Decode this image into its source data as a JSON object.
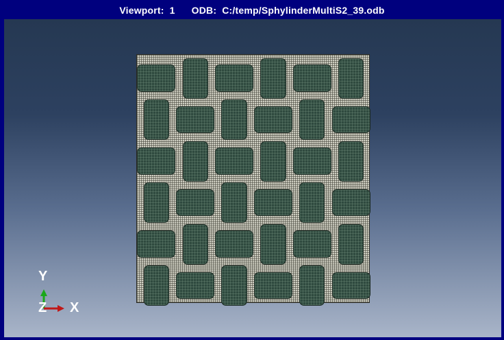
{
  "viewport": {
    "title_label": "Viewport:",
    "number": "1",
    "odb_label": "ODB:",
    "odb_path": "C:/temp/SphylinderMultiS2_39.odb"
  },
  "triad": {
    "y_label": "Y",
    "z_label": "Z",
    "x_label": "X",
    "y_color": "#1aa81a",
    "x_color": "#c01818"
  },
  "colors": {
    "titlebar": "#00007e",
    "mesh_matrix": "#cfcfc2",
    "mesh_inclusion": "#2f4a3f"
  }
}
